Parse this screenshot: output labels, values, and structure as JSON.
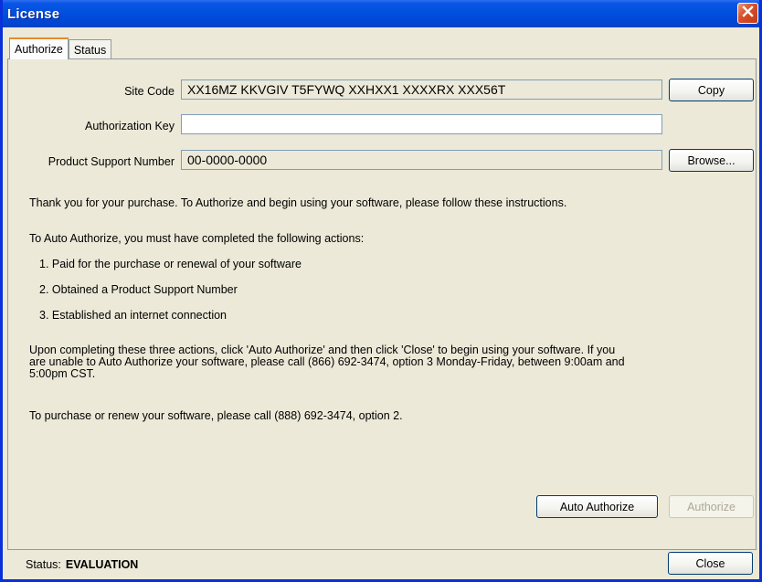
{
  "window": {
    "title": "License"
  },
  "tabs": [
    {
      "label": "Authorize"
    },
    {
      "label": "Status"
    }
  ],
  "form": {
    "site_code_label": "Site Code",
    "site_code_value": "XX16MZ  KKVGIV  T5FYWQ  XXHXX1  XXXXRX  XXX56T",
    "auth_key_label": "Authorization Key",
    "auth_key_value": "",
    "psn_label": "Product Support Number",
    "psn_value": "00-0000-0000",
    "copy_label": "Copy",
    "browse_label": "Browse..."
  },
  "instructions": {
    "intro": "Thank you for your purchase. To Authorize and begin using your software, please follow these instructions.",
    "auto_heading": "To Auto Authorize, you must have completed the following actions:",
    "steps": [
      "1.  Paid for the purchase or renewal of your software",
      "2.  Obtained a Product Support Number",
      "3.  Established an internet connection"
    ],
    "upon_completing_line1": "Upon completing these three actions, click 'Auto Authorize' and then click 'Close' to begin using your software. If you",
    "upon_completing_line2": "are unable to Auto Authorize your software, please call (866) 692-3474, option 3 Monday-Friday, between 9:00am and",
    "upon_completing_line3": "5:00pm CST.",
    "purchase_renew": "To purchase or renew your software, please call (888) 692-3474, option 2."
  },
  "buttons": {
    "auto_authorize": "Auto Authorize",
    "authorize": "Authorize",
    "close": "Close"
  },
  "status": {
    "label": "Status:",
    "value": "EVALUATION"
  },
  "colors": {
    "titlebar": "#0250DE",
    "close_button": "#D9512B",
    "window_bg": "#ECE9D8",
    "field_border": "#7F9DB9",
    "tab_highlight": "#E68B2C"
  },
  "icons": {
    "close": "close-icon"
  }
}
